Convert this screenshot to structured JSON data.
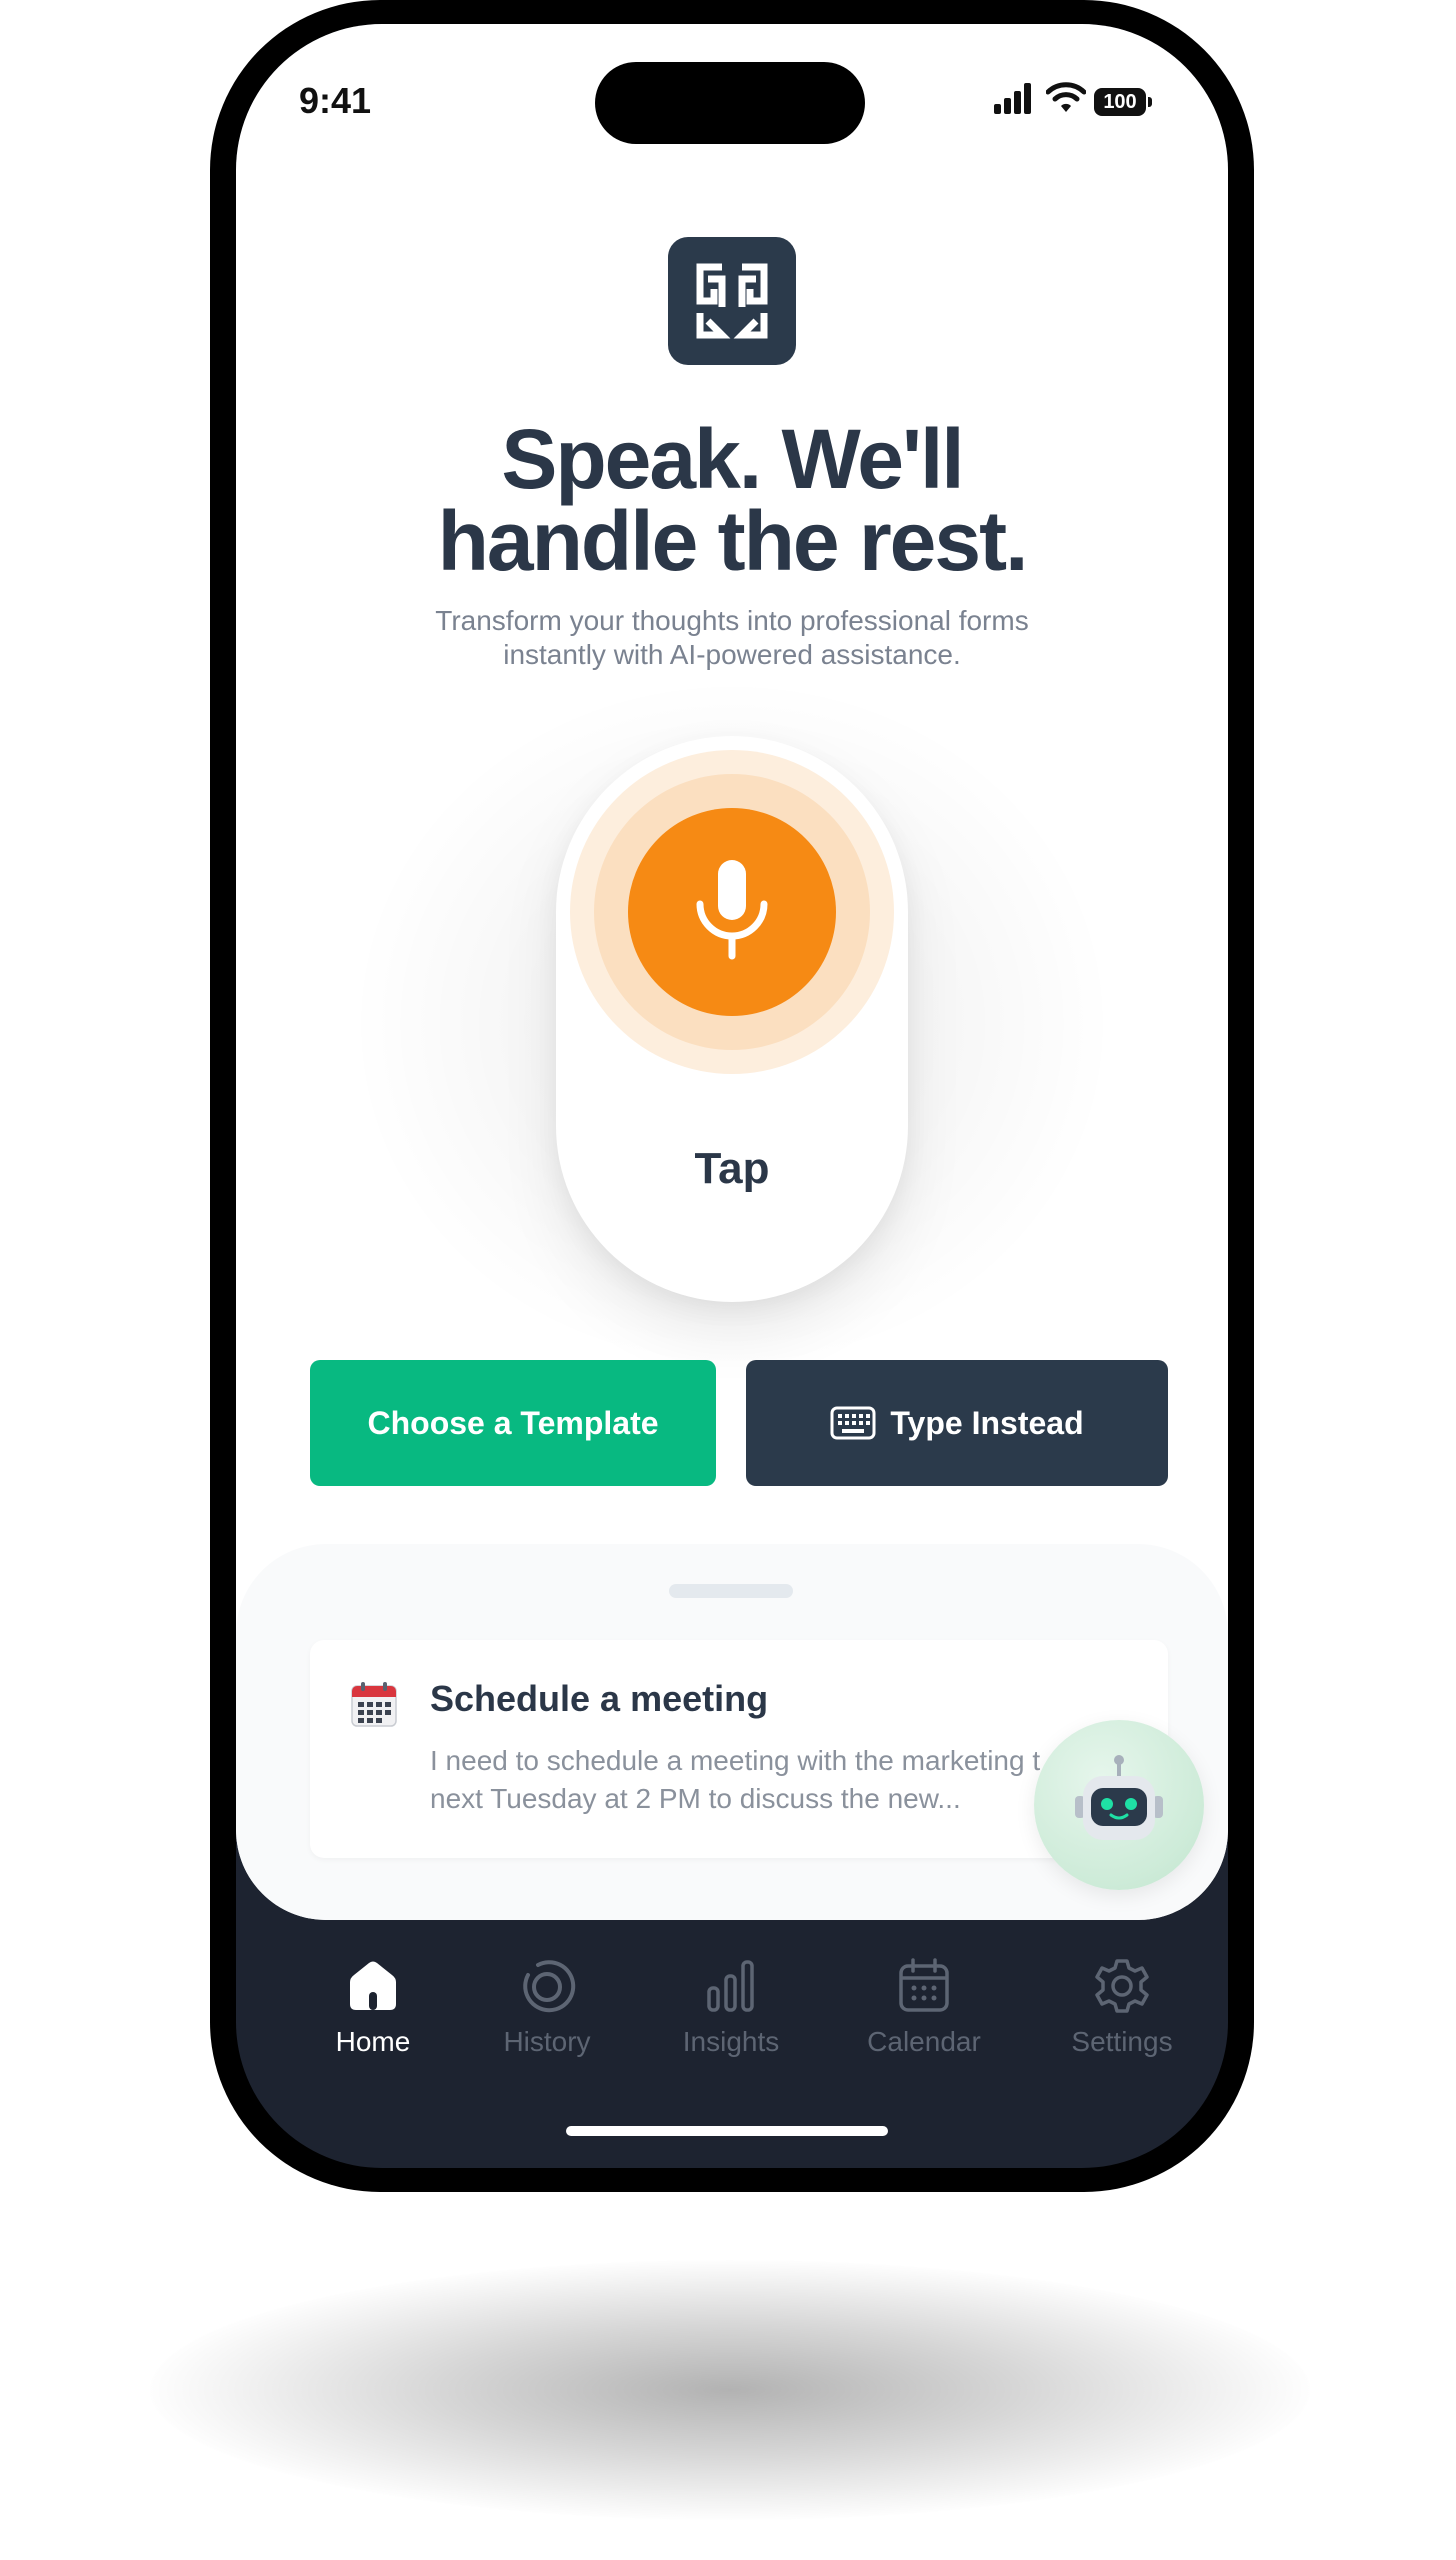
{
  "status_bar": {
    "time": "9:41",
    "battery": "100",
    "icons": [
      "signal-icon",
      "wifi-icon",
      "battery-icon"
    ]
  },
  "app_logo": "app-logo-icon",
  "hero": {
    "headline_line1": "Speak. We'll",
    "headline_line2": "handle the rest.",
    "subtext_line1": "Transform your thoughts into professional forms",
    "subtext_line2": "instantly with AI-powered assistance."
  },
  "mic": {
    "icon": "microphone-icon",
    "label": "Tap"
  },
  "actions": {
    "template_label": "Choose a Template",
    "type_label": "Type Instead",
    "type_icon": "keyboard-icon"
  },
  "suggestion": {
    "icon": "calendar-emoji-icon",
    "title": "Schedule a meeting",
    "body_line1": "I need to schedule a meeting with the marketing t",
    "body_line2": "next Tuesday at 2 PM to discuss the new..."
  },
  "assistant_fab": {
    "icon": "robot-icon"
  },
  "tabbar": {
    "items": [
      {
        "label": "Home",
        "icon": "home-icon",
        "active": true
      },
      {
        "label": "History",
        "icon": "history-icon",
        "active": false
      },
      {
        "label": "Insights",
        "icon": "bar-chart-icon",
        "active": false
      },
      {
        "label": "Calendar",
        "icon": "calendar-icon",
        "active": false
      },
      {
        "label": "Settings",
        "icon": "gear-icon",
        "active": false
      }
    ]
  },
  "colors": {
    "accent_orange": "#f68a14",
    "primary_green": "#08b981",
    "navy": "#2b3a4b",
    "tabbar_bg": "#1d2330"
  }
}
